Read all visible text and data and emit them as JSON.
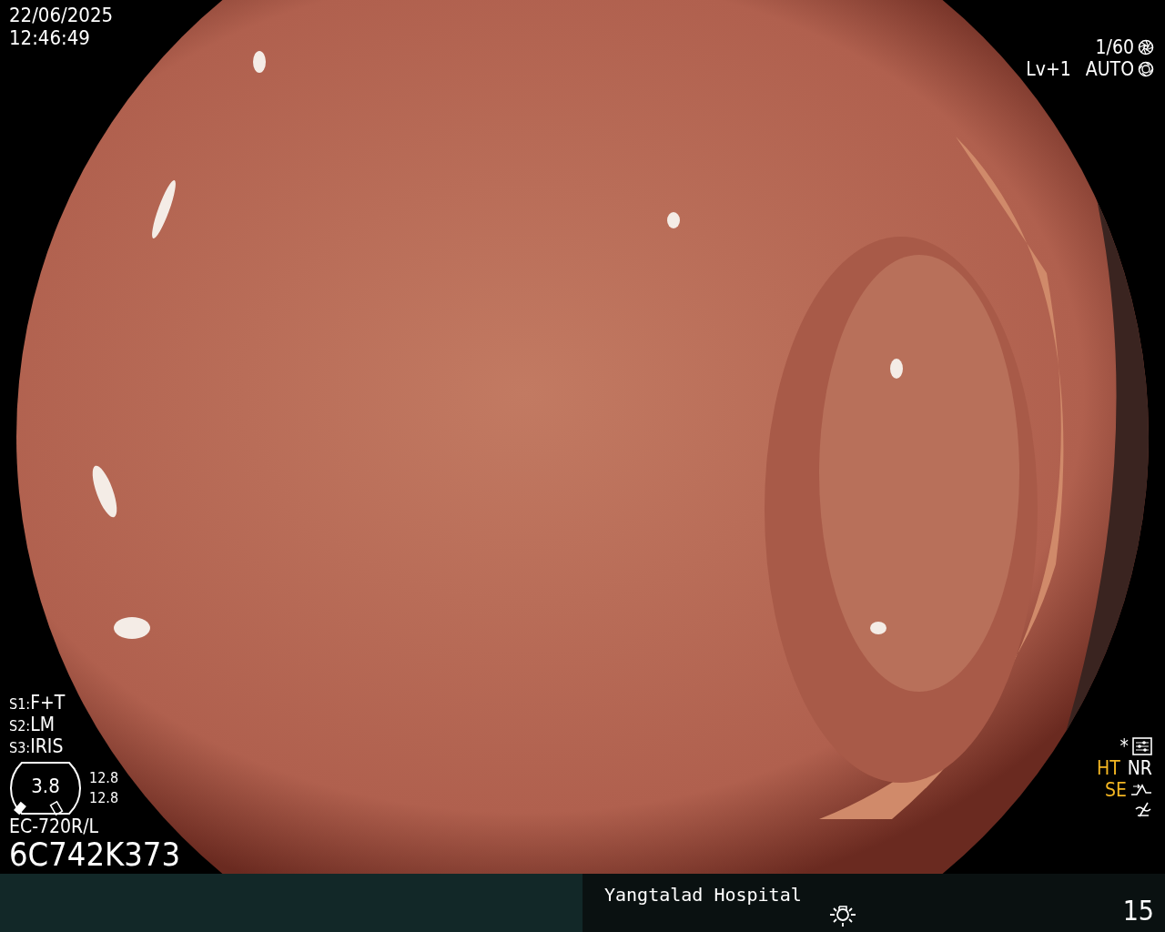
{
  "date": "22/06/2025",
  "time": "12:46:49",
  "shutter": "1/60",
  "exposure_level": "Lv+1",
  "iris": "AUTO",
  "scope_settings": [
    {
      "key": "S1:",
      "value": "F+T"
    },
    {
      "key": "S2:",
      "value": "LM"
    },
    {
      "key": "S3:",
      "value": "IRIS"
    }
  ],
  "gauge": {
    "value": "3.8",
    "reading_1": "12.8",
    "reading_2": "12.8"
  },
  "scope_model": "EC-720R/L",
  "serial": "6C742K373",
  "marker": "*",
  "features": [
    {
      "label": "HT",
      "on": true
    },
    {
      "label": "NR",
      "on": false
    },
    {
      "label": "SE",
      "on": true
    }
  ],
  "hospital": "Yangtalad Hospital",
  "counter": "15"
}
